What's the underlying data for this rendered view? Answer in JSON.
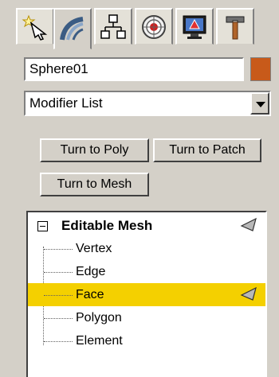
{
  "command_panel": {
    "tabs": [
      {
        "icon": "create-icon",
        "active": false
      },
      {
        "icon": "modify-icon",
        "active": true
      },
      {
        "icon": "hierarchy-icon",
        "active": false
      },
      {
        "icon": "motion-icon",
        "active": false
      },
      {
        "icon": "display-icon",
        "active": false
      },
      {
        "icon": "utilities-icon",
        "active": false
      }
    ]
  },
  "object": {
    "name": "Sphere01",
    "color": "#c85a1a"
  },
  "modifier_list": {
    "selected": "Modifier List"
  },
  "buttons": {
    "turn_to_poly": "Turn to Poly",
    "turn_to_patch": "Turn to Patch",
    "turn_to_mesh": "Turn to Mesh"
  },
  "stack": {
    "modifier": "Editable Mesh",
    "sub_objects": [
      {
        "label": "Vertex",
        "selected": false
      },
      {
        "label": "Edge",
        "selected": false
      },
      {
        "label": "Face",
        "selected": true
      },
      {
        "label": "Polygon",
        "selected": false
      },
      {
        "label": "Element",
        "selected": false
      }
    ],
    "highlight_color": "#f4d000"
  }
}
